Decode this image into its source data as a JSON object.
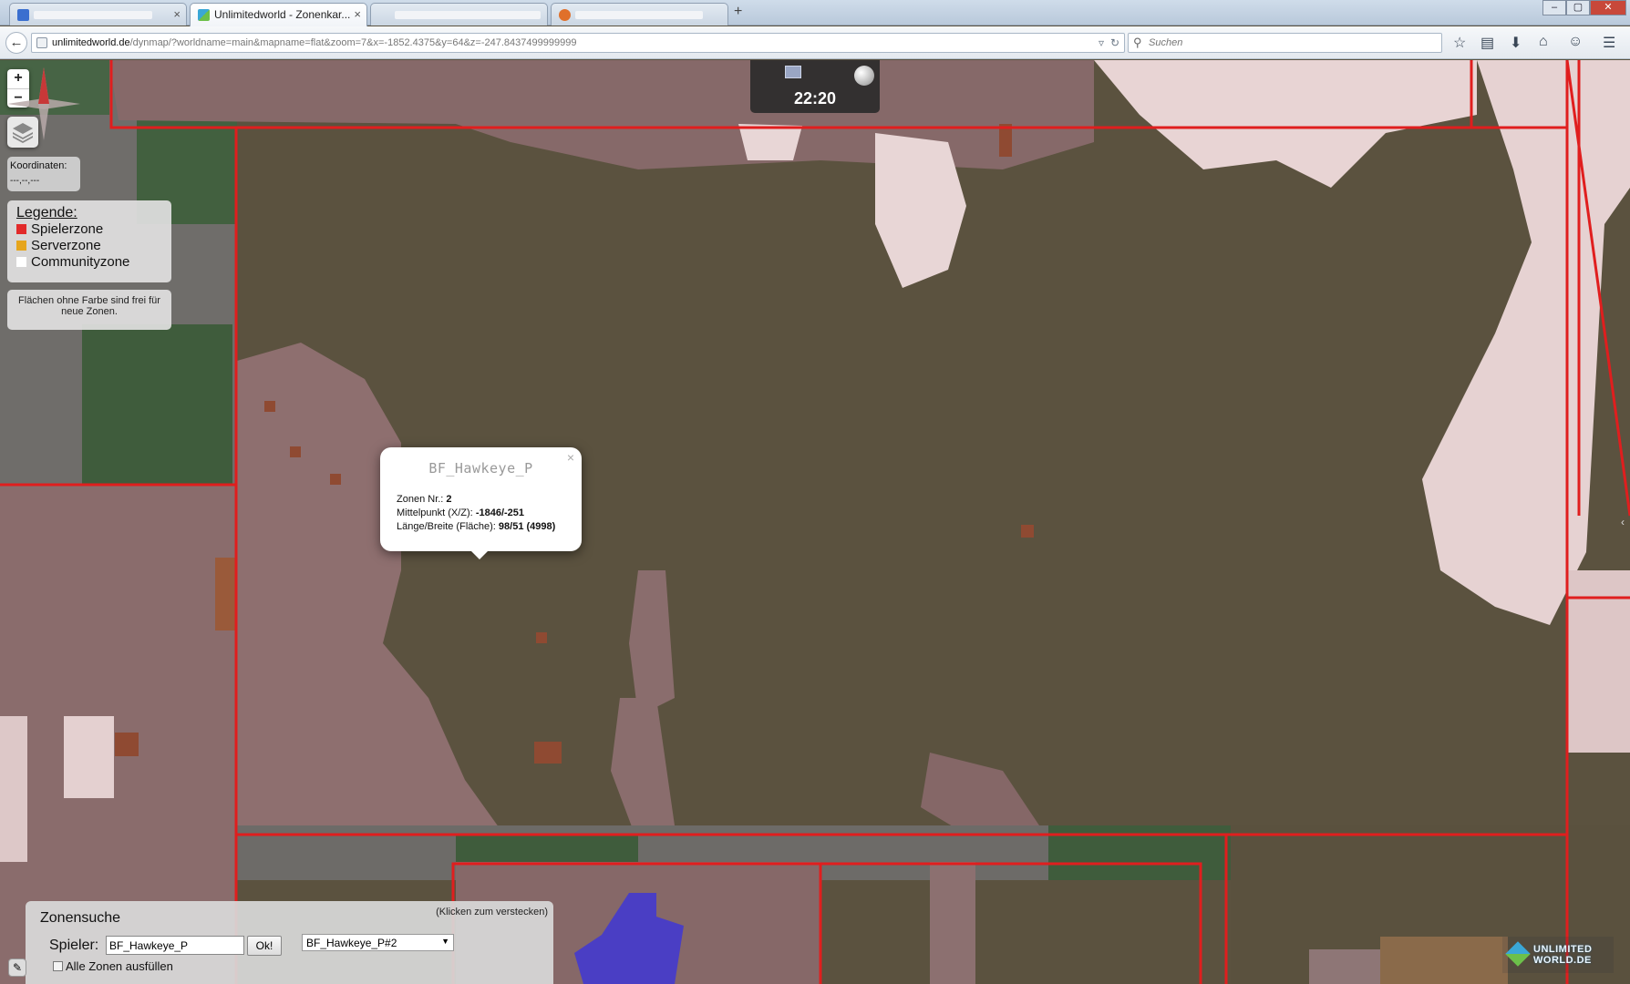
{
  "browser": {
    "tabs": [
      {
        "label": "",
        "close": "×"
      },
      {
        "label": "Unlimitedworld - Zonenkar...",
        "close": "×"
      },
      {
        "label": "",
        "close": ""
      },
      {
        "label": "",
        "close": ""
      }
    ],
    "new_tab": "+",
    "window_controls": [
      "–",
      "▢",
      "✕"
    ],
    "back": "←",
    "url_host": "unlimitedworld.de",
    "url_path": "/dynmap/?worldname=main&mapname=flat&zoom=7&x=-1852.4375&y=64&z=-247.8437499999999",
    "search_placeholder": "Suchen",
    "toolbar_icons": [
      "star-icon",
      "bookmarks-icon",
      "download-icon",
      "home-icon",
      "chat-icon",
      "menu-icon"
    ]
  },
  "map": {
    "zoom_in": "+",
    "zoom_out": "−",
    "coords": {
      "label": "Koordinaten:",
      "value": "---,--,---"
    },
    "legend": {
      "title": "Legende:",
      "items": [
        {
          "label": "Spielerzone",
          "color": "#e22a2a"
        },
        {
          "label": "Serverzone",
          "color": "#e6a51c"
        },
        {
          "label": "Communityzone",
          "color": "#ffffff"
        }
      ]
    },
    "note": "Flächen ohne Farbe sind frei für neue Zonen.",
    "clock": {
      "time": "22:20"
    },
    "popup": {
      "title": "BF_Hawkeye_P",
      "close": "×",
      "zone_nr_label": "Zonen Nr.:",
      "zone_nr": "2",
      "center_label": "Mittelpunkt (X/Z):",
      "center": "-1846/-251",
      "size_label": "Länge/Breite (Fläche):",
      "size": "98/51 (4998)"
    },
    "zone_search": {
      "title": "Zonensuche",
      "hide_link": "(Klicken zum verstecken)",
      "player_label": "Spieler:",
      "player_value": "BF_Hawkeye_P",
      "ok_label": "Ok!",
      "select_value": "BF_Hawkeye_P#2",
      "all_zones_label": "Alle Zonen ausfüllen"
    },
    "logo": {
      "line1": "UNLIMITED",
      "line2": "WORLD.DE"
    },
    "colors": {
      "zone_border": "#e01e1e",
      "dirt": "#5b523f",
      "pink": "#8e6f6f",
      "snow": "#e6d2d2",
      "grass": "#3f5c3c",
      "stone": "#717171",
      "water": "#4a3ec4"
    }
  }
}
